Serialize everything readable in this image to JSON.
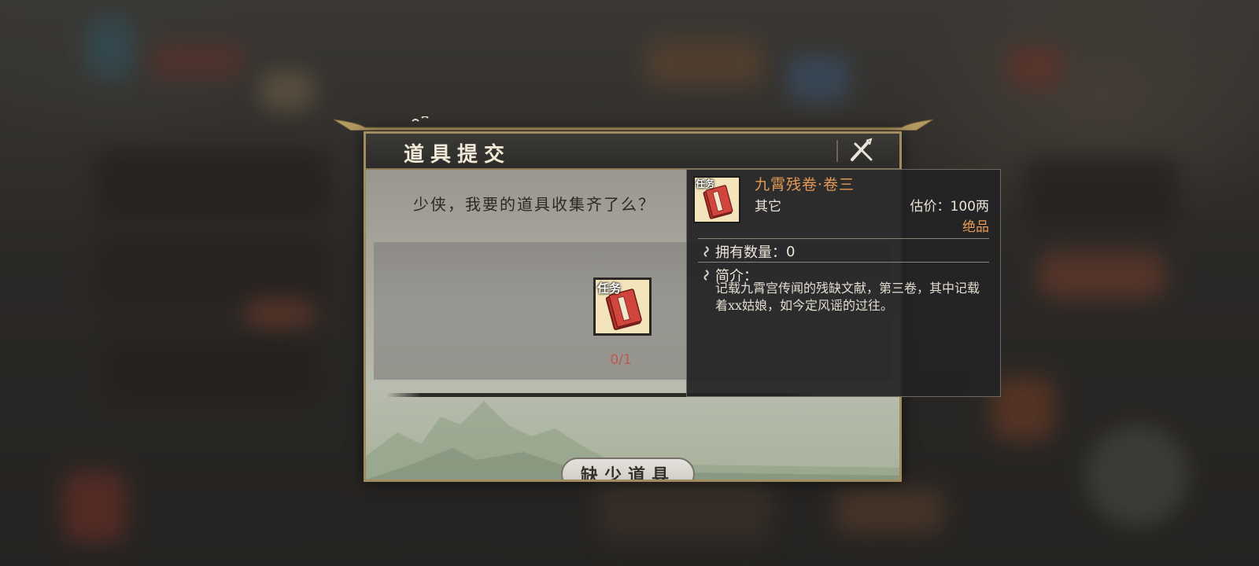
{
  "dialog": {
    "title": "道具提交",
    "prompt": "少侠，我要的道具收集齐了么？",
    "item": {
      "tag": "任务",
      "count": "0/1"
    },
    "submit_label": "缺少道具",
    "close_icon": "close-icon"
  },
  "tooltip": {
    "tag": "任务",
    "name": "九霄残卷·卷三",
    "type": "其它",
    "price_label": "估价：",
    "price_value": "100两",
    "rarity": "绝品",
    "owned_label": "拥有数量：",
    "owned_value": "0",
    "desc_label": "简介：",
    "description": "记载九霄宫传闻的残缺文献，第三卷，其中记载着xx姑娘，如今定风谣的过往。"
  },
  "colors": {
    "accent_orange": "#e59a55",
    "count_red": "#c0574c",
    "frame_gold": "#a28b60"
  }
}
